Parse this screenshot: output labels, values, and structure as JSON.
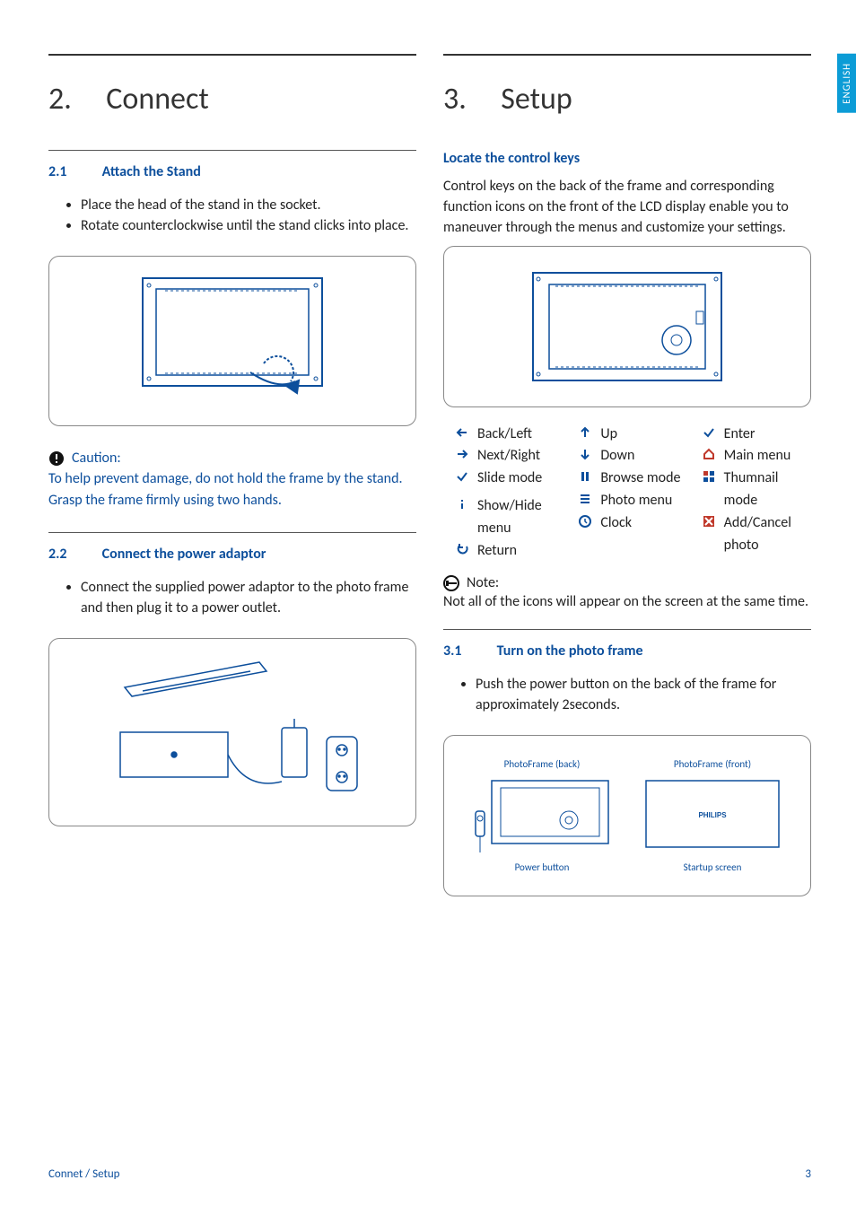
{
  "lang_tab": "ENGLISH",
  "left": {
    "title_num": "2.",
    "title": "Connect",
    "s21_num": "2.1",
    "s21_title": "Attach the Stand",
    "s21_b1": "Place the head of the stand in the socket.",
    "s21_b2": "Rotate counterclockwise until the stand clicks into place.",
    "caution_label": "Caution:",
    "caution_text": "To help prevent damage, do not hold the frame by the stand. Grasp the frame firmly using two hands.",
    "s22_num": "2.2",
    "s22_title": "Connect the power adaptor",
    "s22_b1": "Connect the supplied power adaptor to the photo frame and then plug it to a power outlet."
  },
  "right": {
    "title_num": "3.",
    "title": "Setup",
    "locate_title": "Locate the control keys",
    "locate_text": "Control keys on the back of the frame and corresponding function icons on the front of the LCD display enable you to maneuver through the menus and customize your settings.",
    "keys": {
      "back_left": "Back/Left",
      "next_right": "Next/Right",
      "slide_mode": "Slide mode",
      "show_hide": "Show/Hide menu",
      "return": "Return",
      "up": "Up",
      "down": "Down",
      "browse_mode": "Browse mode",
      "photo_menu": "Photo menu",
      "clock": "Clock",
      "enter": "Enter",
      "main_menu": "Main menu",
      "thumbnail_mode": "Thumnail mode",
      "add_cancel": "Add/Cancel photo"
    },
    "note_label": "Note:",
    "note_text": "Not all of the icons will appear on the screen at the same time.",
    "s31_num": "3.1",
    "s31_title": "Turn on the photo frame",
    "s31_b1": "Push the power button on the back of the frame for approximately 2seconds.",
    "fig_back_title": "PhotoFrame (back)",
    "fig_front_title": "PhotoFrame (front)",
    "fig_power_label": "Power button",
    "fig_startup_label": "Startup screen",
    "fig_brand": "PHILIPS"
  },
  "footer": {
    "section": "Connet / Setup",
    "page": "3"
  }
}
